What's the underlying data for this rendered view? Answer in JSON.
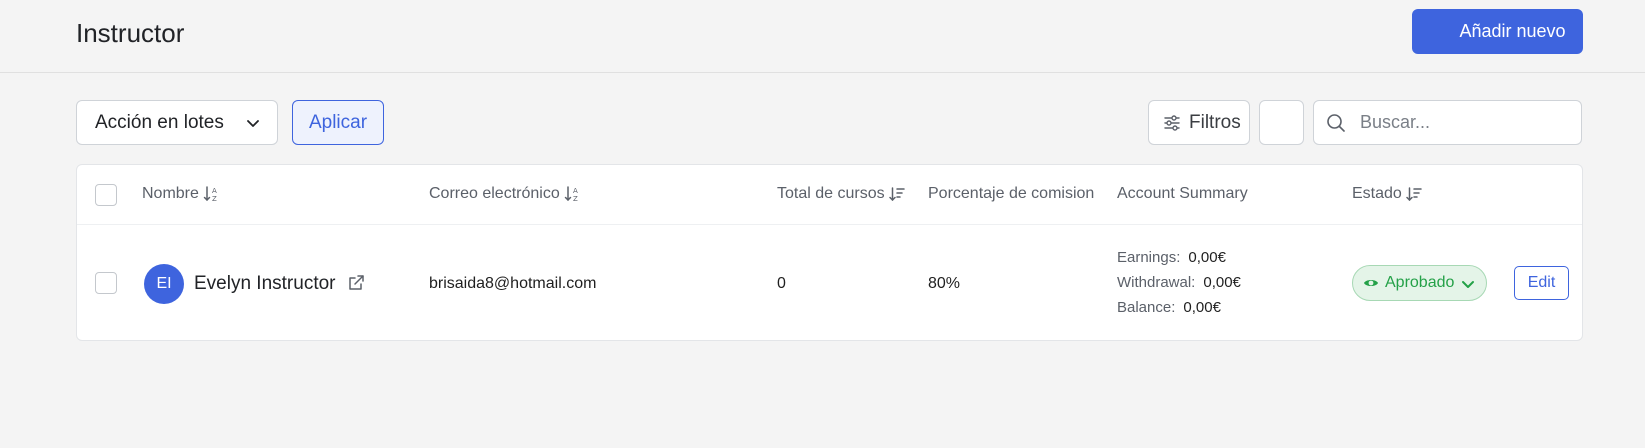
{
  "header": {
    "title": "Instructor",
    "add_new_label": "Añadir nuevo"
  },
  "toolbar": {
    "bulk_action_label": "Acción en lotes",
    "apply_label": "Aplicar",
    "filters_label": "Filtros",
    "search_placeholder": "Buscar..."
  },
  "table": {
    "columns": {
      "name": "Nombre",
      "email": "Correo electrónico",
      "total_courses": "Total de cursos",
      "commission": "Porcentaje de comision",
      "account_summary": "Account Summary",
      "status": "Estado"
    },
    "rows": [
      {
        "avatar_initials": "EI",
        "name": "Evelyn Instructor",
        "email": "brisaida8@hotmail.com",
        "total_courses": "0",
        "commission": "80%",
        "earnings_label": "Earnings:",
        "earnings": "0,00€",
        "withdrawal_label": "Withdrawal:",
        "withdrawal": "0,00€",
        "balance_label": "Balance:",
        "balance": "0,00€",
        "status": "Aprobado",
        "edit_label": "Edit"
      }
    ]
  },
  "colors": {
    "accent": "#3e64de",
    "status_green": "#24a148",
    "status_bg": "#e4f4e8"
  }
}
